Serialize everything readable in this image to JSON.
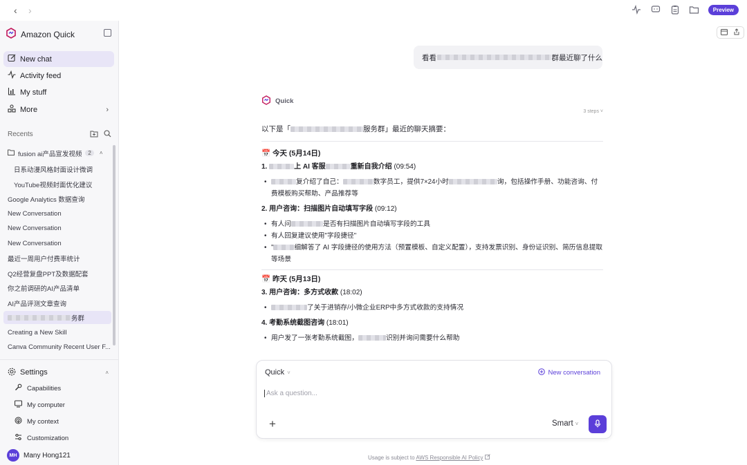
{
  "topbar": {
    "back": "‹",
    "forward": "›",
    "preview_label": "Preview"
  },
  "app": {
    "name": "Amazon Quick"
  },
  "nav": [
    {
      "label": "New chat"
    },
    {
      "label": "Activity feed"
    },
    {
      "label": "My stuff"
    },
    {
      "label": "More"
    }
  ],
  "recents": {
    "label": "Recents",
    "folder": {
      "label": "fusion ai产品宣发视频",
      "count": "2"
    },
    "sub_items": [
      "日系动漫风格封面设计微调",
      "YouTube视频封面优化建议"
    ],
    "items": [
      "Google Analytics 数据查询",
      "New Conversation",
      "New Conversation",
      "New Conversation",
      "最近一周用户付费率统计",
      "Q2经营复盘PPT及数据配套",
      "你之前调研的AI产品清单",
      "AI产品评测文章查询"
    ],
    "active_item_suffix": "务群",
    "tail_items": [
      "Creating a New Skill",
      "Canva Community Recent User F..."
    ]
  },
  "settings": {
    "label": "Settings",
    "items": [
      "Capabilities",
      "My computer",
      "My context",
      "Customization"
    ]
  },
  "user": {
    "initials": "MH",
    "name": "Many Hong121"
  },
  "chat": {
    "user_message": {
      "prefix": "看看",
      "suffix": "群最近聊了什么"
    },
    "agent_name": "Quick",
    "steps": "3 steps",
    "intro": {
      "prefix": "以下是「",
      "suffix": "服务群」最近的聊天摘要："
    },
    "day1": "📅 今天 (5月14日)",
    "t1": {
      "num": "1. ",
      "mid1": "上 AI 客服",
      "mid2": "重新自我介绍",
      "time": " (09:54)"
    },
    "t1_b1": {
      "a": "复介绍了自己：",
      "b": "数字员工，提供7×24小时",
      "c": "询，包括操作手册、功能咨询、付费模板购买帮助、产品推荐等"
    },
    "t2": {
      "title": "2. 用户咨询：扫描图片自动填写字段",
      "time": " (09:12)"
    },
    "t2_b1": {
      "a": "有人问",
      "b": "是否有扫描图片自动填写字段的工具"
    },
    "t2_b2": "有人回复建议使用\"字段捷径\"",
    "t2_b3": {
      "a": "\"",
      "b": "细解答了 AI 字段捷径的使用方法（预置模板、自定义配置），支持发票识别、身份证识别、简历信息提取等场景"
    },
    "day2": "📅 昨天 (5月13日)",
    "t3": {
      "title": "3. 用户咨询：多方式收款",
      "time": " (18:02)"
    },
    "t3_b1": "了关于进销存/小微企业ERP中多方式收款的支持情况",
    "t4": {
      "title": "4. 考勤系统截图咨询",
      "time": " (18:01)"
    },
    "t4_b1": {
      "a": "用户发了一张考勤系统截图，",
      "b": "识别并询问需要什么帮助"
    }
  },
  "composer": {
    "agent": "Quick",
    "new_conversation": "New conversation",
    "placeholder": "Ask a question...",
    "model": "Smart"
  },
  "footer": {
    "text": "Usage is subject to ",
    "link": "AWS Responsible AI Policy"
  },
  "colors": {
    "accent": "#5b3fd9",
    "active_bg": "#e8e5f7"
  }
}
